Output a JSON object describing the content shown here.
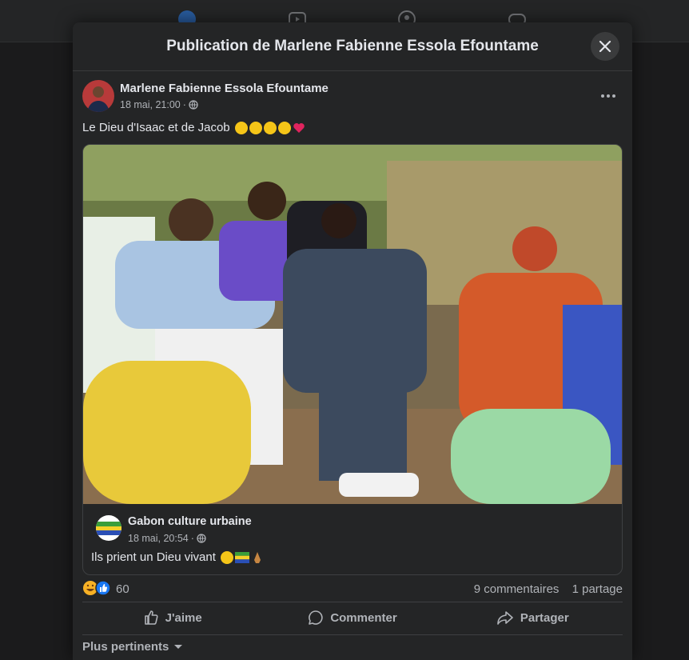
{
  "modal": {
    "title": "Publication de Marlene Fabienne Essola Efountame"
  },
  "post": {
    "author": "Marlene Fabienne Essola Efountame",
    "date": "18 mai, 21:00",
    "dot": "·",
    "text": "Le Dieu d'Isaac et de Jacob",
    "emojis": [
      "grinning-sweat",
      "grinning-sweat",
      "grinning-sweat",
      "grinning-sweat",
      "red-heart"
    ]
  },
  "shared": {
    "author": "Gabon culture urbaine",
    "date": "18 mai, 20:54",
    "dot": "·",
    "text": "Ils prient un Dieu vivant",
    "emojis": [
      "pleading-face",
      "flag-gabon",
      "folded-hands"
    ]
  },
  "reactions": {
    "count": "60",
    "comments": "9 commentaires",
    "shares": "1 partage"
  },
  "actions": {
    "like": "J'aime",
    "comment": "Commenter",
    "share": "Partager"
  },
  "sort": {
    "label": "Plus pertinents"
  },
  "colors": {
    "background": "#1b1b1c",
    "surface": "#242526",
    "text": "#e4e6eb",
    "secondary": "#b0b3b8",
    "like_blue": "#1877f2"
  }
}
